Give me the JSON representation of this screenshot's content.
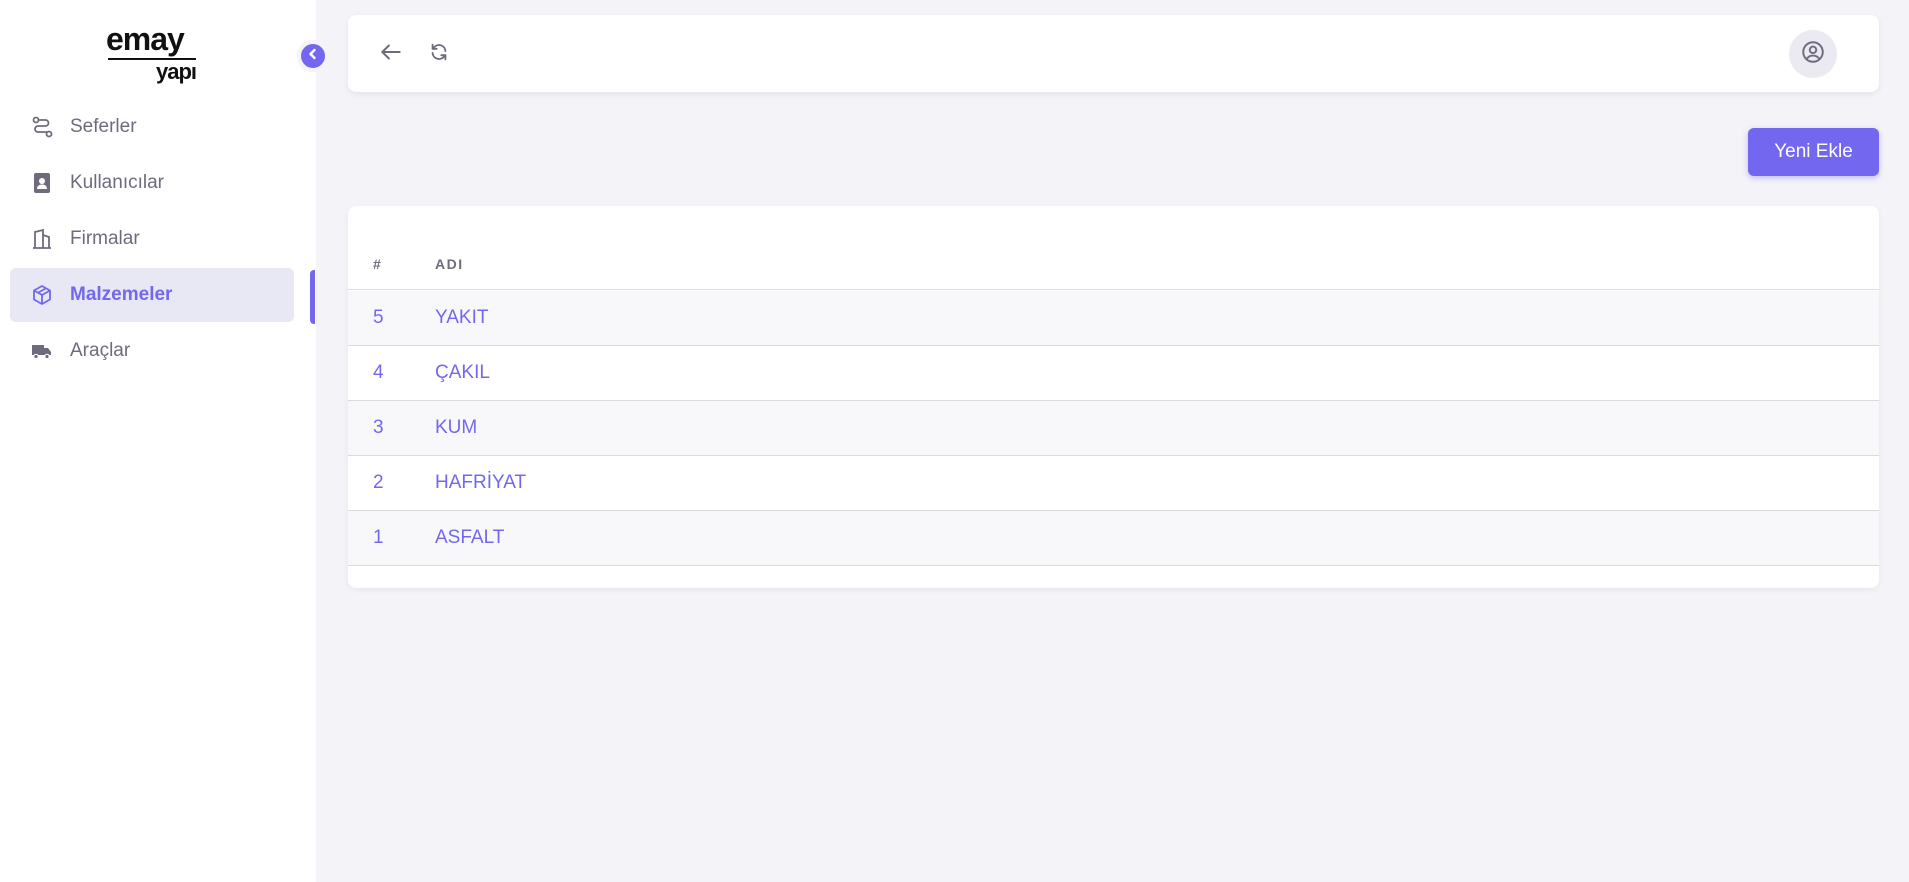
{
  "brand": {
    "line1": "emay",
    "line2": "yapı"
  },
  "sidebar": {
    "items": [
      {
        "label": "Seferler",
        "icon": "route-icon"
      },
      {
        "label": "Kullanıcılar",
        "icon": "address-book-icon"
      },
      {
        "label": "Firmalar",
        "icon": "building-icon"
      },
      {
        "label": "Malzemeler",
        "icon": "package-icon",
        "active": true
      },
      {
        "label": "Araçlar",
        "icon": "truck-icon"
      }
    ]
  },
  "toolbar": {
    "add_label": "Yeni Ekle"
  },
  "table": {
    "columns": [
      "#",
      "ADI"
    ],
    "rows": [
      {
        "id": "5",
        "name": "YAKIT"
      },
      {
        "id": "4",
        "name": "ÇAKIL"
      },
      {
        "id": "3",
        "name": "KUM"
      },
      {
        "id": "2",
        "name": "HAFRİYAT"
      },
      {
        "id": "1",
        "name": "ASFALT"
      }
    ]
  },
  "colors": {
    "accent": "#7367f0",
    "background": "#f3f3f8",
    "text": "#6f6b7d"
  }
}
